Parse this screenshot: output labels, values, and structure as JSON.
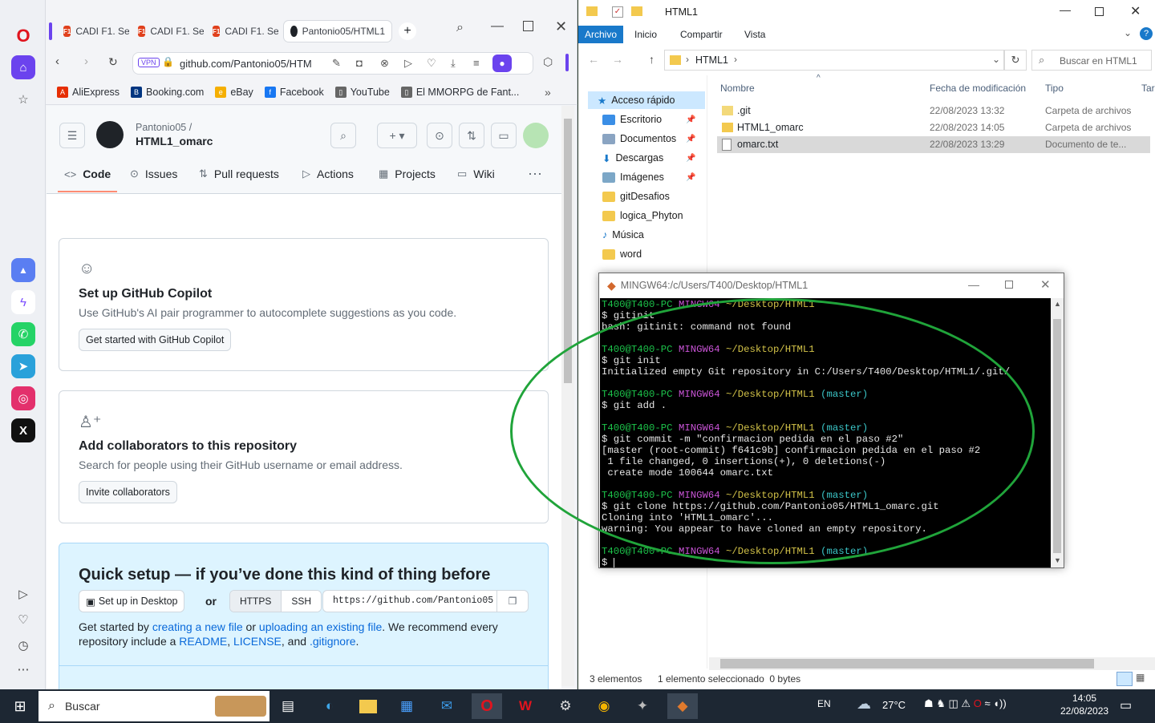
{
  "browser": {
    "tabs": [
      {
        "label": "CADI F1. Se",
        "active": false
      },
      {
        "label": "CADI F1. Se",
        "active": false
      },
      {
        "label": "CADI F1. Se",
        "active": false
      },
      {
        "label": "Pantonio05/HTML1",
        "active": true
      }
    ],
    "url": "github.com/Pantonio05/HTM",
    "vpn_label": "VPN",
    "bookmarks": [
      "AliExpress",
      "Booking.com",
      "eBay",
      "Facebook",
      "YouTube",
      "El MMORPG de Fant..."
    ]
  },
  "github": {
    "owner": "Pantonio05 /",
    "repo": "HTML1_omarc",
    "tabs": [
      "Code",
      "Issues",
      "Pull requests",
      "Actions",
      "Projects",
      "Wiki"
    ],
    "copilot": {
      "title": "Set up GitHub Copilot",
      "desc": "Use GitHub's AI pair programmer to autocomplete suggestions as you code.",
      "button": "Get started with GitHub Copilot"
    },
    "collab": {
      "title": "Add collaborators to this repository",
      "desc": "Search for people using their GitHub username or email address.",
      "button": "Invite collaborators"
    },
    "quick": {
      "title": "Quick setup — if you’ve done this kind of thing before",
      "desktop_button": "Set up in Desktop",
      "or": "or",
      "https": "HTTPS",
      "ssh": "SSH",
      "clone_url": "https://github.com/Pantonio05",
      "text_a": "Get started by ",
      "link_new": "creating a new file",
      "text_b": " or ",
      "link_upload": "uploading an existing file",
      "text_c": ". We recommend every",
      "text_d": "repository include a ",
      "link_readme": "README",
      "sep1": ", ",
      "link_license": "LICENSE",
      "text_e": ", and ",
      "link_gitignore": ".gitignore",
      "text_f": "."
    }
  },
  "explorer": {
    "title": "HTML1",
    "ribbon": [
      "Archivo",
      "Inicio",
      "Compartir",
      "Vista"
    ],
    "path": "HTML1",
    "search_placeholder": "Buscar en HTML1",
    "columns": [
      "Nombre",
      "Fecha de modificación",
      "Tipo",
      "Tar"
    ],
    "nav": [
      {
        "label": "Acceso rápido",
        "pinned": false
      },
      {
        "label": "Escritorio",
        "pinned": true
      },
      {
        "label": "Documentos",
        "pinned": true
      },
      {
        "label": "Descargas",
        "pinned": true
      },
      {
        "label": "Imágenes",
        "pinned": true
      },
      {
        "label": "gitDesafios",
        "pinned": false
      },
      {
        "label": "logica_Phyton",
        "pinned": false
      },
      {
        "label": "Música",
        "pinned": false
      },
      {
        "label": "word",
        "pinned": false
      }
    ],
    "files": [
      {
        "name": ".git",
        "date": "22/08/2023 13:32",
        "type": "Carpeta de archivos"
      },
      {
        "name": "HTML1_omarc",
        "date": "22/08/2023 14:05",
        "type": "Carpeta de archivos"
      },
      {
        "name": "omarc.txt",
        "date": "22/08/2023 13:29",
        "type": "Documento de te..."
      }
    ],
    "status_count": "3 elementos",
    "status_selection": "1 elemento seleccionado  0 bytes"
  },
  "terminal": {
    "title": "MINGW64:/c/Users/T400/Desktop/HTML1",
    "prompt_user": "T400@T400-PC",
    "prompt_env": "MINGW64",
    "prompt_path": "~/Desktop/HTML1",
    "branch": "(master)",
    "cmd1": "$ gitinit",
    "out1": "bash: gitinit: command not found",
    "cmd2": "$ git init",
    "out2": "Initialized empty Git repository in C:/Users/T400/Desktop/HTML1/.git/",
    "cmd3": "$ git add .",
    "cmd4": "$ git commit -m \"confirmacion pedida en el paso #2\"",
    "out4a": "[master (root-commit) f641c9b] confirmacion pedida en el paso #2",
    "out4b": " 1 file changed, 0 insertions(+), 0 deletions(-)",
    "out4c": " create mode 100644 omarc.txt",
    "cmd5": "$ git clone https://github.com/Pantonio05/HTML1_omarc.git",
    "out5a": "Cloning into 'HTML1_omarc'...",
    "out5b": "warning: You appear to have cloned an empty repository.",
    "cmd6": "$ "
  },
  "taskbar": {
    "search_label": "Buscar",
    "lang": "EN",
    "weather": "27°C",
    "time": "14:05",
    "date": "22/08/2023"
  },
  "colors": {
    "annotation_ellipse": "#20a43a",
    "opera_red": "#e0141e",
    "github_link": "#0969da",
    "explorer_accent": "#1979ca"
  }
}
